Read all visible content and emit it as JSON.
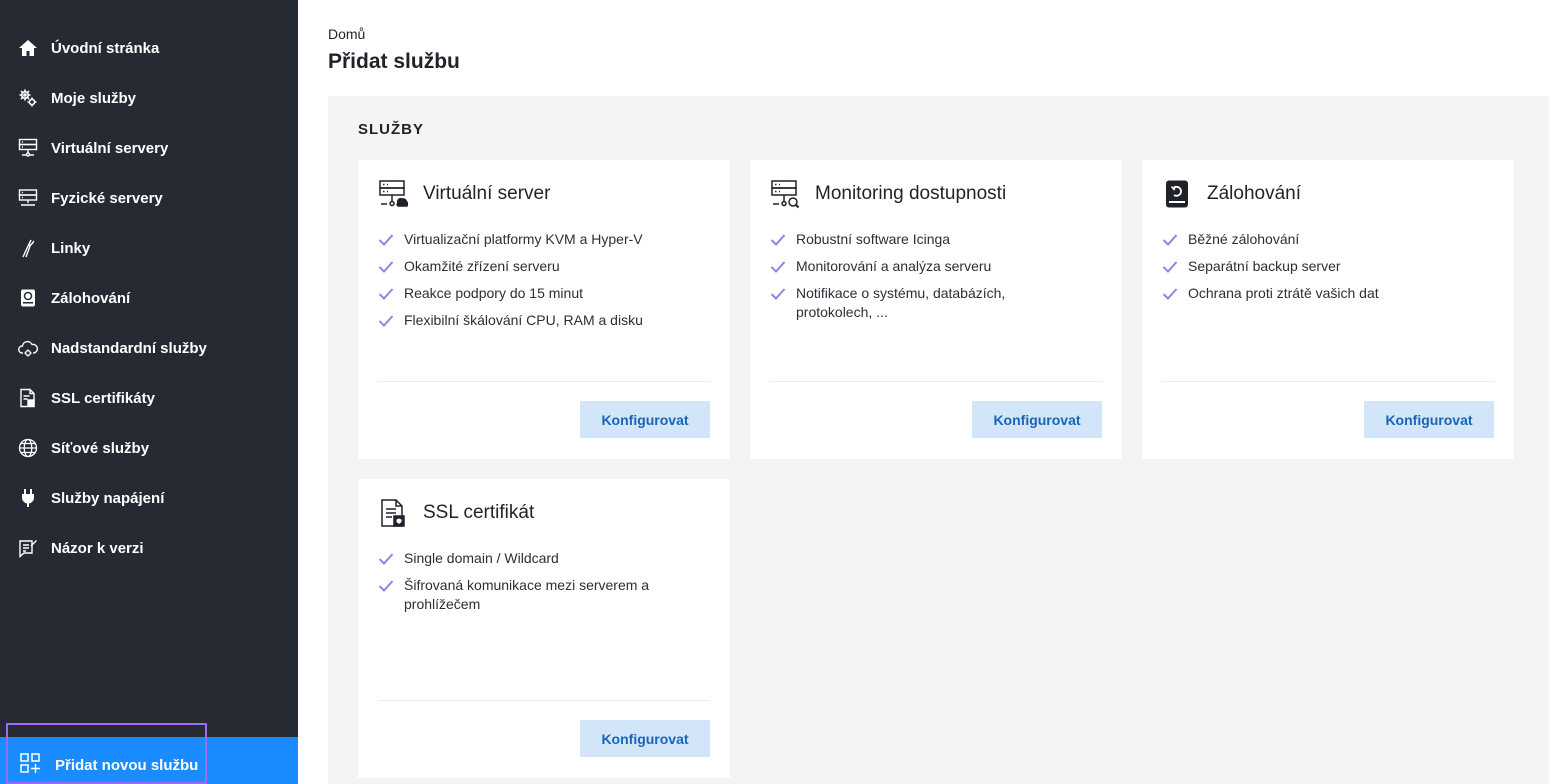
{
  "sidebar": {
    "items": [
      {
        "label": "Úvodní stránka",
        "icon": "home-icon"
      },
      {
        "label": "Moje služby",
        "icon": "gears-icon"
      },
      {
        "label": "Virtuální servery",
        "icon": "virtual-server-icon"
      },
      {
        "label": "Fyzické servery",
        "icon": "physical-server-icon"
      },
      {
        "label": "Linky",
        "icon": "fiber-icon"
      },
      {
        "label": "Zálohování",
        "icon": "backup-icon"
      },
      {
        "label": "Nadstandardní služby",
        "icon": "cloud-cog-icon"
      },
      {
        "label": "SSL certifikáty",
        "icon": "certificate-icon"
      },
      {
        "label": "Síťové služby",
        "icon": "globe-icon"
      },
      {
        "label": "Služby napájení",
        "icon": "plug-icon"
      },
      {
        "label": "Názor k verzi",
        "icon": "feedback-icon"
      }
    ],
    "add_service": {
      "label": "Přidat novou službu",
      "icon": "add-grid-icon"
    }
  },
  "header": {
    "breadcrumb": "Domů",
    "title": "Přidat službu"
  },
  "services": {
    "section_title": "SLUŽBY",
    "cards": [
      {
        "title": "Virtuální server",
        "icon": "virtual-server-icon",
        "features": [
          "Virtualizační platformy KVM a Hyper-V",
          "Okamžité zřízení serveru",
          "Reakce podpory do 15 minut",
          "Flexibilní škálování CPU, RAM a disku"
        ],
        "button": "Konfigurovat"
      },
      {
        "title": "Monitoring dostupnosti",
        "icon": "monitoring-server-icon",
        "features": [
          "Robustní software Icinga",
          "Monitorování a analýza serveru",
          "Notifikace o systému, databázích, protokolech, ..."
        ],
        "button": "Konfigurovat"
      },
      {
        "title": "Zálohování",
        "icon": "backup-icon",
        "features": [
          "Běžné zálohování",
          "Separátní backup server",
          "Ochrana proti ztrátě vašich dat"
        ],
        "button": "Konfigurovat"
      },
      {
        "title": "SSL certifikát",
        "icon": "certificate-icon",
        "features": [
          "Single domain / Wildcard",
          "Šifrovaná komunikace mezi serverem a prohlížečem"
        ],
        "button": "Konfigurovat"
      }
    ]
  },
  "colors": {
    "sidebar_bg": "#262a33",
    "accent_blue": "#1a8cff",
    "highlight_border": "#9b6cf2",
    "check": "#9d7fe0",
    "button_bg": "#d3e5f9",
    "button_text": "#1767b8"
  }
}
